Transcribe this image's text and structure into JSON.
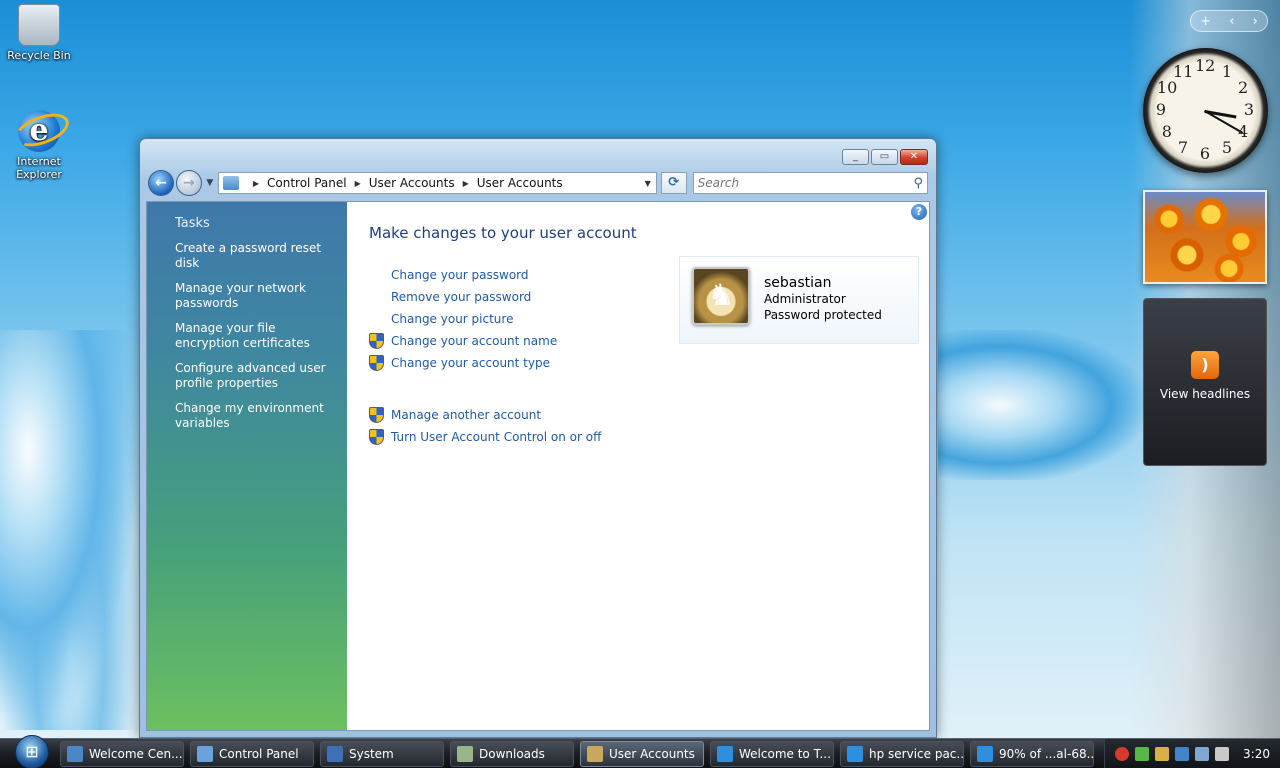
{
  "desktop": {
    "icons": [
      {
        "label": "Recycle Bin"
      },
      {
        "label": "Internet Explorer"
      }
    ]
  },
  "gadgets": {
    "clock_numbers": [
      "12",
      "1",
      "2",
      "3",
      "4",
      "5",
      "6",
      "7",
      "8",
      "9",
      "10",
      "11"
    ],
    "clock_time": "3:20",
    "feed_label": "View headlines"
  },
  "window": {
    "address": [
      "Control Panel",
      "User Accounts",
      "User Accounts"
    ],
    "search_placeholder": "Search",
    "tasks": {
      "title": "Tasks",
      "items": [
        "Create a password reset disk",
        "Manage your network passwords",
        "Manage your file encryption certificates",
        "Configure advanced user profile properties",
        "Change my environment variables"
      ]
    },
    "main": {
      "title": "Make changes to your user account",
      "links": [
        {
          "label": "Change your password",
          "shield": false
        },
        {
          "label": "Remove your password",
          "shield": false
        },
        {
          "label": "Change your picture",
          "shield": false
        },
        {
          "label": "Change your account name",
          "shield": true
        },
        {
          "label": "Change your account type",
          "shield": true
        }
      ],
      "links2": [
        {
          "label": "Manage another account",
          "shield": true
        },
        {
          "label": "Turn User Account Control on or off",
          "shield": true
        }
      ]
    },
    "user": {
      "name": "sebastian",
      "role": "Administrator",
      "status": "Password protected"
    }
  },
  "taskbar": {
    "buttons": [
      {
        "label": "Welcome Cen...",
        "icon_color": "#4a86c8"
      },
      {
        "label": "Control Panel",
        "icon_color": "#6aa3da"
      },
      {
        "label": "System",
        "icon_color": "#3f6fb6"
      },
      {
        "label": "Downloads",
        "icon_color": "#9bb58a"
      },
      {
        "label": "User Accounts",
        "icon_color": "#c9a75c"
      },
      {
        "label": "Welcome to T...",
        "icon_color": "#2d8fe0"
      },
      {
        "label": "hp service pac...",
        "icon_color": "#2d8fe0"
      },
      {
        "label": "90% of ...al-68....",
        "icon_color": "#2d8fe0"
      }
    ],
    "active_index": 4,
    "time": "3:20"
  },
  "colors": {
    "link": "#1d5aa8",
    "title": "#1e3e84"
  }
}
